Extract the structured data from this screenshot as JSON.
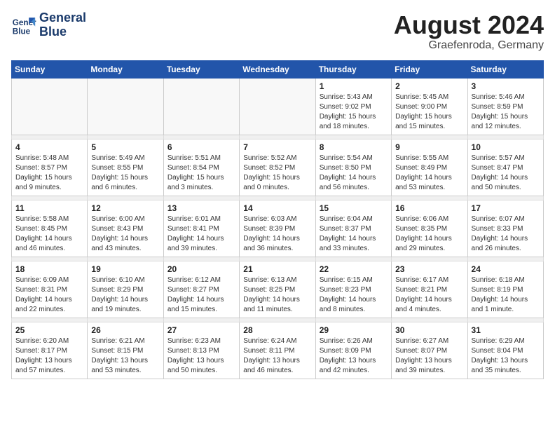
{
  "logo": {
    "line1": "General",
    "line2": "Blue"
  },
  "title": "August 2024",
  "location": "Graefenroda, Germany",
  "weekdays": [
    "Sunday",
    "Monday",
    "Tuesday",
    "Wednesday",
    "Thursday",
    "Friday",
    "Saturday"
  ],
  "weeks": [
    [
      {
        "day": "",
        "info": ""
      },
      {
        "day": "",
        "info": ""
      },
      {
        "day": "",
        "info": ""
      },
      {
        "day": "",
        "info": ""
      },
      {
        "day": "1",
        "info": "Sunrise: 5:43 AM\nSunset: 9:02 PM\nDaylight: 15 hours\nand 18 minutes."
      },
      {
        "day": "2",
        "info": "Sunrise: 5:45 AM\nSunset: 9:00 PM\nDaylight: 15 hours\nand 15 minutes."
      },
      {
        "day": "3",
        "info": "Sunrise: 5:46 AM\nSunset: 8:59 PM\nDaylight: 15 hours\nand 12 minutes."
      }
    ],
    [
      {
        "day": "4",
        "info": "Sunrise: 5:48 AM\nSunset: 8:57 PM\nDaylight: 15 hours\nand 9 minutes."
      },
      {
        "day": "5",
        "info": "Sunrise: 5:49 AM\nSunset: 8:55 PM\nDaylight: 15 hours\nand 6 minutes."
      },
      {
        "day": "6",
        "info": "Sunrise: 5:51 AM\nSunset: 8:54 PM\nDaylight: 15 hours\nand 3 minutes."
      },
      {
        "day": "7",
        "info": "Sunrise: 5:52 AM\nSunset: 8:52 PM\nDaylight: 15 hours\nand 0 minutes."
      },
      {
        "day": "8",
        "info": "Sunrise: 5:54 AM\nSunset: 8:50 PM\nDaylight: 14 hours\nand 56 minutes."
      },
      {
        "day": "9",
        "info": "Sunrise: 5:55 AM\nSunset: 8:49 PM\nDaylight: 14 hours\nand 53 minutes."
      },
      {
        "day": "10",
        "info": "Sunrise: 5:57 AM\nSunset: 8:47 PM\nDaylight: 14 hours\nand 50 minutes."
      }
    ],
    [
      {
        "day": "11",
        "info": "Sunrise: 5:58 AM\nSunset: 8:45 PM\nDaylight: 14 hours\nand 46 minutes."
      },
      {
        "day": "12",
        "info": "Sunrise: 6:00 AM\nSunset: 8:43 PM\nDaylight: 14 hours\nand 43 minutes."
      },
      {
        "day": "13",
        "info": "Sunrise: 6:01 AM\nSunset: 8:41 PM\nDaylight: 14 hours\nand 39 minutes."
      },
      {
        "day": "14",
        "info": "Sunrise: 6:03 AM\nSunset: 8:39 PM\nDaylight: 14 hours\nand 36 minutes."
      },
      {
        "day": "15",
        "info": "Sunrise: 6:04 AM\nSunset: 8:37 PM\nDaylight: 14 hours\nand 33 minutes."
      },
      {
        "day": "16",
        "info": "Sunrise: 6:06 AM\nSunset: 8:35 PM\nDaylight: 14 hours\nand 29 minutes."
      },
      {
        "day": "17",
        "info": "Sunrise: 6:07 AM\nSunset: 8:33 PM\nDaylight: 14 hours\nand 26 minutes."
      }
    ],
    [
      {
        "day": "18",
        "info": "Sunrise: 6:09 AM\nSunset: 8:31 PM\nDaylight: 14 hours\nand 22 minutes."
      },
      {
        "day": "19",
        "info": "Sunrise: 6:10 AM\nSunset: 8:29 PM\nDaylight: 14 hours\nand 19 minutes."
      },
      {
        "day": "20",
        "info": "Sunrise: 6:12 AM\nSunset: 8:27 PM\nDaylight: 14 hours\nand 15 minutes."
      },
      {
        "day": "21",
        "info": "Sunrise: 6:13 AM\nSunset: 8:25 PM\nDaylight: 14 hours\nand 11 minutes."
      },
      {
        "day": "22",
        "info": "Sunrise: 6:15 AM\nSunset: 8:23 PM\nDaylight: 14 hours\nand 8 minutes."
      },
      {
        "day": "23",
        "info": "Sunrise: 6:17 AM\nSunset: 8:21 PM\nDaylight: 14 hours\nand 4 minutes."
      },
      {
        "day": "24",
        "info": "Sunrise: 6:18 AM\nSunset: 8:19 PM\nDaylight: 14 hours\nand 1 minute."
      }
    ],
    [
      {
        "day": "25",
        "info": "Sunrise: 6:20 AM\nSunset: 8:17 PM\nDaylight: 13 hours\nand 57 minutes."
      },
      {
        "day": "26",
        "info": "Sunrise: 6:21 AM\nSunset: 8:15 PM\nDaylight: 13 hours\nand 53 minutes."
      },
      {
        "day": "27",
        "info": "Sunrise: 6:23 AM\nSunset: 8:13 PM\nDaylight: 13 hours\nand 50 minutes."
      },
      {
        "day": "28",
        "info": "Sunrise: 6:24 AM\nSunset: 8:11 PM\nDaylight: 13 hours\nand 46 minutes."
      },
      {
        "day": "29",
        "info": "Sunrise: 6:26 AM\nSunset: 8:09 PM\nDaylight: 13 hours\nand 42 minutes."
      },
      {
        "day": "30",
        "info": "Sunrise: 6:27 AM\nSunset: 8:07 PM\nDaylight: 13 hours\nand 39 minutes."
      },
      {
        "day": "31",
        "info": "Sunrise: 6:29 AM\nSunset: 8:04 PM\nDaylight: 13 hours\nand 35 minutes."
      }
    ]
  ]
}
